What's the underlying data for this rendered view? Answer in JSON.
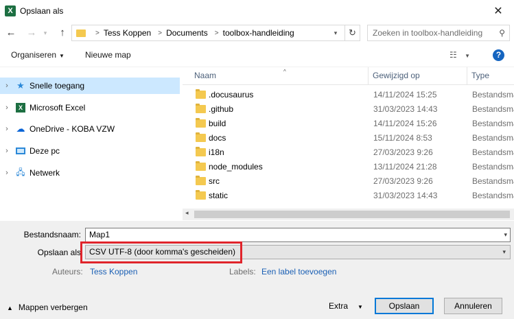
{
  "window": {
    "title": "Opslaan als",
    "app_icon_letter": "X",
    "close_symbol": "✕"
  },
  "nav": {
    "back_icon": "arrow-left",
    "forward_icon": "arrow-right",
    "up_icon": "arrow-up"
  },
  "address": {
    "breadcrumbs": [
      "Tess Koppen",
      "Documents",
      "toolbox-handleiding"
    ]
  },
  "search": {
    "placeholder": "Zoeken in toolbox-handleiding"
  },
  "toolbar": {
    "organize_label": "Organiseren",
    "new_folder_label": "Nieuwe map",
    "help_label": "?"
  },
  "sidebar": {
    "items": [
      {
        "label": "Snelle toegang",
        "icon": "star-icon",
        "selected": true
      },
      {
        "label": "Microsoft Excel",
        "icon": "excel-icon",
        "selected": false
      },
      {
        "label": "OneDrive - KOBA VZW",
        "icon": "cloud-icon",
        "selected": false
      },
      {
        "label": "Deze pc",
        "icon": "pc-icon",
        "selected": false
      },
      {
        "label": "Netwerk",
        "icon": "network-icon",
        "selected": false
      }
    ]
  },
  "files": {
    "columns": {
      "name": "Naam",
      "modified": "Gewijzigd op",
      "type": "Type"
    },
    "rows": [
      {
        "name": ".docusaurus",
        "date": "14/11/2024 15:25",
        "type": "Bestandsmap"
      },
      {
        "name": ".github",
        "date": "31/03/2023 14:43",
        "type": "Bestandsmap"
      },
      {
        "name": "build",
        "date": "14/11/2024 15:26",
        "type": "Bestandsmap"
      },
      {
        "name": "docs",
        "date": "15/11/2024 8:53",
        "type": "Bestandsmap"
      },
      {
        "name": "i18n",
        "date": "27/03/2023 9:26",
        "type": "Bestandsmap"
      },
      {
        "name": "node_modules",
        "date": "13/11/2024 21:28",
        "type": "Bestandsmap"
      },
      {
        "name": "src",
        "date": "27/03/2023 9:26",
        "type": "Bestandsmap"
      },
      {
        "name": "static",
        "date": "31/03/2023 14:43",
        "type": "Bestandsmap"
      }
    ]
  },
  "save": {
    "filename_label": "Bestandsnaam:",
    "filename_value": "Map1",
    "filetype_label": "Opslaan als",
    "filetype_value": "CSV UTF-8 (door komma's gescheiden)",
    "authors_label": "Auteurs:",
    "authors_value": "Tess Koppen",
    "labels_label": "Labels:",
    "labels_value": "Een label toevoegen",
    "hide_folders_label": "Mappen verbergen",
    "extra_label": "Extra",
    "save_button": "Opslaan",
    "cancel_button": "Annuleren"
  }
}
